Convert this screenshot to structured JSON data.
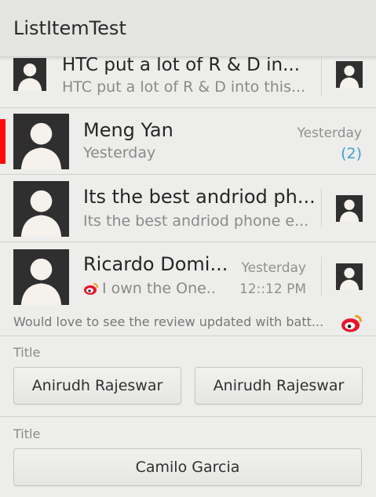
{
  "app": {
    "title": "ListItemTest"
  },
  "items": [
    {
      "title": "HTC put a lot of R & D in...",
      "subtitle": "HTC put a lot of R & D into this..."
    },
    {
      "title": "Meng Yan",
      "subtitle": "Yesterday",
      "time": "Yesterday",
      "count": "(2)"
    },
    {
      "title": "Its the best andriod ph...",
      "subtitle": "Its the best andriod phone e..."
    },
    {
      "title": "Ricardo Domi...",
      "subtitle": "I own the One..",
      "time": "Yesterday",
      "time2": "12::12 PM"
    }
  ],
  "footer": {
    "text": "Would love to see the review updated with batt..."
  },
  "sections": [
    {
      "label": "Title",
      "buttons": [
        "Anirudh Rajeswar",
        "Anirudh Rajeswar"
      ]
    },
    {
      "label": "Title",
      "buttons": [
        "Camilo Garcia"
      ]
    }
  ],
  "colors": {
    "unread": "#ff0a0a",
    "count": "#3aa0d6",
    "weibo": "#e6162d"
  },
  "icons": [
    "person-avatar-icon",
    "weibo-icon"
  ]
}
